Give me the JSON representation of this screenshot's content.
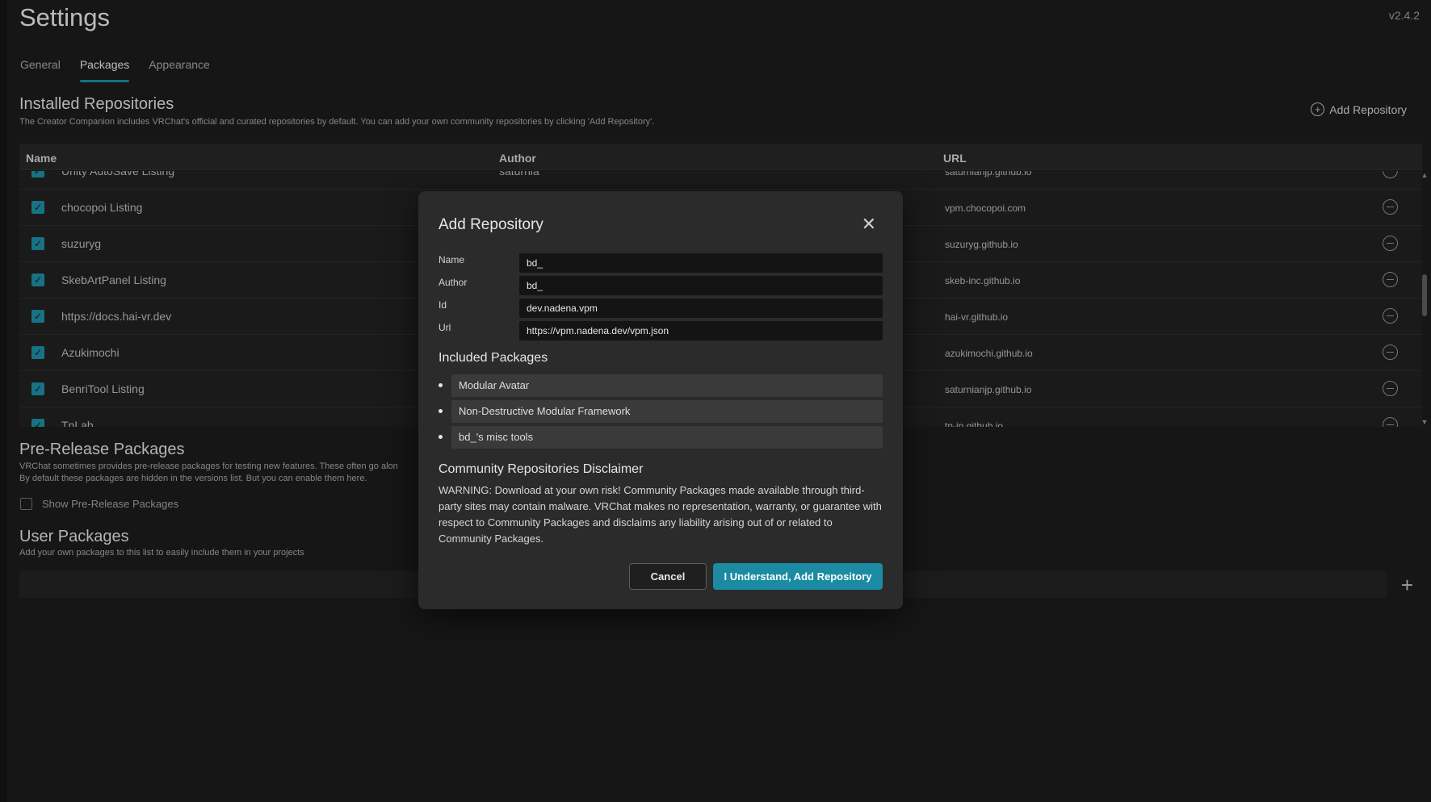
{
  "header": {
    "title": "Settings",
    "version": "v2.4.2"
  },
  "tabs": [
    {
      "label": "General"
    },
    {
      "label": "Packages"
    },
    {
      "label": "Appearance"
    }
  ],
  "installed": {
    "title": "Installed Repositories",
    "description": "The Creator Companion includes VRChat's official and curated repositories by default. You can add your own community repositories by clicking 'Add Repository'.",
    "add_label": "Add Repository",
    "columns": {
      "name": "Name",
      "author": "Author",
      "url": "URL"
    },
    "rows": [
      {
        "name": "Unity AutoSave Listing",
        "author": "saturnia",
        "url": "saturnianjp.github.io"
      },
      {
        "name": "chocopoi Listing",
        "author": "",
        "url": "vpm.chocopoi.com"
      },
      {
        "name": "suzuryg",
        "author": "",
        "url": "suzuryg.github.io"
      },
      {
        "name": "SkebArtPanel Listing",
        "author": "",
        "url": "skeb-inc.github.io"
      },
      {
        "name": "https://docs.hai-vr.dev",
        "author": "",
        "url": "hai-vr.github.io"
      },
      {
        "name": "Azukimochi",
        "author": "",
        "url": "azukimochi.github.io"
      },
      {
        "name": "BenriTool Listing",
        "author": "",
        "url": "saturnianjp.github.io"
      },
      {
        "name": "TnLab",
        "author": "",
        "url": "tn-jp.github.io"
      }
    ]
  },
  "prerelease": {
    "title": "Pre-Release Packages",
    "line1": "VRChat sometimes provides pre-release packages for testing new features. These often go alon",
    "line2": "By default these packages are hidden in the versions list. But you can enable them here.",
    "checkbox_label": "Show Pre-Release Packages"
  },
  "user_packages": {
    "title": "User Packages",
    "description": "Add your own packages to this list to easily include them in your projects"
  },
  "modal": {
    "title": "Add Repository",
    "fields": {
      "name": {
        "label": "Name",
        "value": "bd_"
      },
      "author": {
        "label": "Author",
        "value": "bd_"
      },
      "id": {
        "label": "Id",
        "value": "dev.nadena.vpm"
      },
      "url": {
        "label": "Url",
        "value": "https://vpm.nadena.dev/vpm.json"
      }
    },
    "packages_title": "Included Packages",
    "packages": [
      "Modular Avatar",
      "Non-Destructive Modular Framework",
      "bd_'s misc tools"
    ],
    "disclaimer_title": "Community Repositories Disclaimer",
    "disclaimer_text": "WARNING: Download at your own risk! Community Packages made available through third-party sites may contain malware. VRChat makes no representation, warranty, or guarantee with respect to Community Packages and disclaims any liability arising out of or related to Community Packages.",
    "cancel_label": "Cancel",
    "confirm_label": "I Understand, Add Repository"
  },
  "colors": {
    "accent": "#1a8ba3",
    "background": "#1b1b1b",
    "modal": "#2b2b2b"
  },
  "icons": {
    "close": "close-icon",
    "add": "plus-circle-icon",
    "remove": "minus-circle-icon",
    "check": "check-icon"
  }
}
